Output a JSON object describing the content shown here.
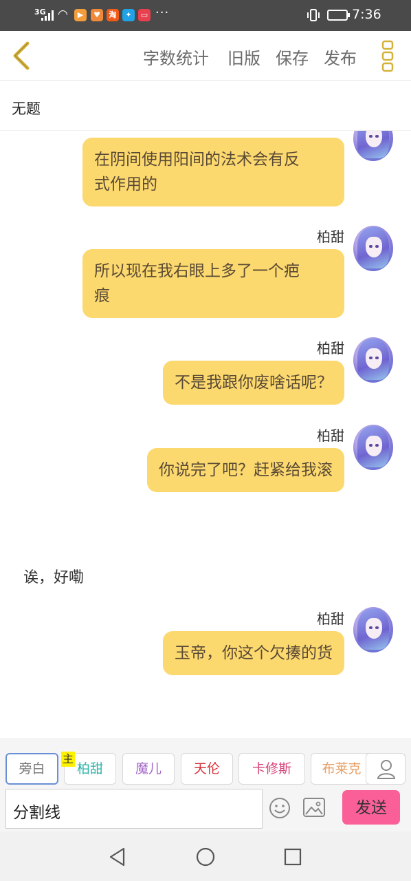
{
  "statusbar": {
    "signal_label": "3G",
    "time": "7:36",
    "more_indicator": "···",
    "app_icons": [
      {
        "name": "video-app-icon",
        "color": "#f39c3c",
        "glyph": "▶"
      },
      {
        "name": "heart-app-icon",
        "color": "#f08a3a",
        "glyph": "♥"
      },
      {
        "name": "taobao-app-icon",
        "color": "#f25a1a",
        "glyph": "淘"
      },
      {
        "name": "browser-app-icon",
        "color": "#1fa3e6",
        "glyph": "✦"
      },
      {
        "name": "red-app-icon",
        "color": "#e8404f",
        "glyph": "▭"
      }
    ]
  },
  "toolbar": {
    "back_icon": "chevron-left-icon",
    "word_count": "字数统计",
    "old_version": "旧版",
    "save": "保存",
    "publish": "发布",
    "more_icon": "vertical-dots-icon"
  },
  "document": {
    "title": "无题"
  },
  "messages": [
    {
      "type": "bubble",
      "speaker": "",
      "text_lines": [
        "在阴间使用阳间的法术会有反",
        "式作用的"
      ]
    },
    {
      "type": "bubble",
      "speaker": "柏甜",
      "text_lines": [
        "所以现在我右眼上多了一个疤",
        "痕"
      ]
    },
    {
      "type": "bubble",
      "speaker": "柏甜",
      "text_lines": [
        "不是我跟你废啥话呢？"
      ]
    },
    {
      "type": "bubble",
      "speaker": "柏甜",
      "text_lines": [
        "你说完了吧？赶紧给我滚"
      ]
    },
    {
      "type": "narration",
      "text": "诶，好嘞"
    },
    {
      "type": "bubble",
      "speaker": "柏甜",
      "text_lines": [
        "玉帝，你这个欠揍的货"
      ]
    }
  ],
  "characters": [
    {
      "label": "旁白",
      "color": "#777777",
      "selected": true
    },
    {
      "label": "柏甜",
      "color": "#2bb4a8",
      "tag": "主"
    },
    {
      "label": "魔儿",
      "color": "#a468c9"
    },
    {
      "label": "天伦",
      "color": "#d6323a"
    },
    {
      "label": "卡修斯",
      "color": "#d8467a"
    },
    {
      "label": "布莱克",
      "color": "#e8a066"
    }
  ],
  "input": {
    "value": "分割线",
    "send_label": "发送",
    "emoji_icon": "smiley-icon",
    "image_icon": "image-icon"
  },
  "colors": {
    "bubble": "#fcd96f",
    "send_button": "#fb5f98",
    "accent": "#d4b23a"
  }
}
